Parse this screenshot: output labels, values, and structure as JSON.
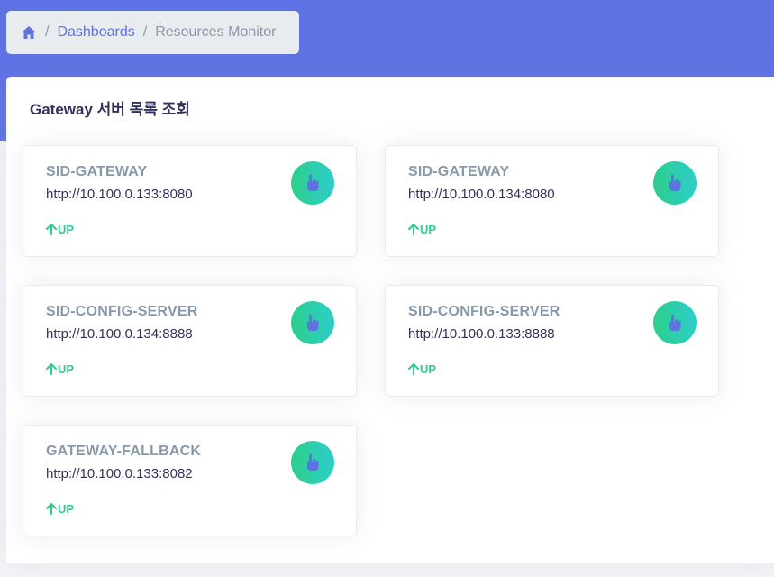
{
  "breadcrumb": {
    "home_icon": "home-icon",
    "items": [
      "Dashboards",
      "Resources Monitor"
    ],
    "separator": "/"
  },
  "panel": {
    "title": "Gateway 서버 목록 조회"
  },
  "services": [
    {
      "name": "SID-GATEWAY",
      "url": "http://10.100.0.133:8080",
      "status": "UP",
      "icon": "pointer-hand-icon"
    },
    {
      "name": "SID-GATEWAY",
      "url": "http://10.100.0.134:8080",
      "status": "UP",
      "icon": "pointer-hand-icon"
    },
    {
      "name": "SID-CONFIG-SERVER",
      "url": "http://10.100.0.134:8888",
      "status": "UP",
      "icon": "pointer-hand-icon"
    },
    {
      "name": "SID-CONFIG-SERVER",
      "url": "http://10.100.0.133:8888",
      "status": "UP",
      "icon": "pointer-hand-icon"
    },
    {
      "name": "GATEWAY-FALLBACK",
      "url": "http://10.100.0.133:8082",
      "status": "UP",
      "icon": "pointer-hand-icon"
    }
  ],
  "colors": {
    "header": "#5e72e4",
    "status_up": "#2dce89",
    "icon_gradient_start": "#2dce89",
    "icon_gradient_end": "#2dcecc",
    "hand_icon": "#5e72e4"
  }
}
